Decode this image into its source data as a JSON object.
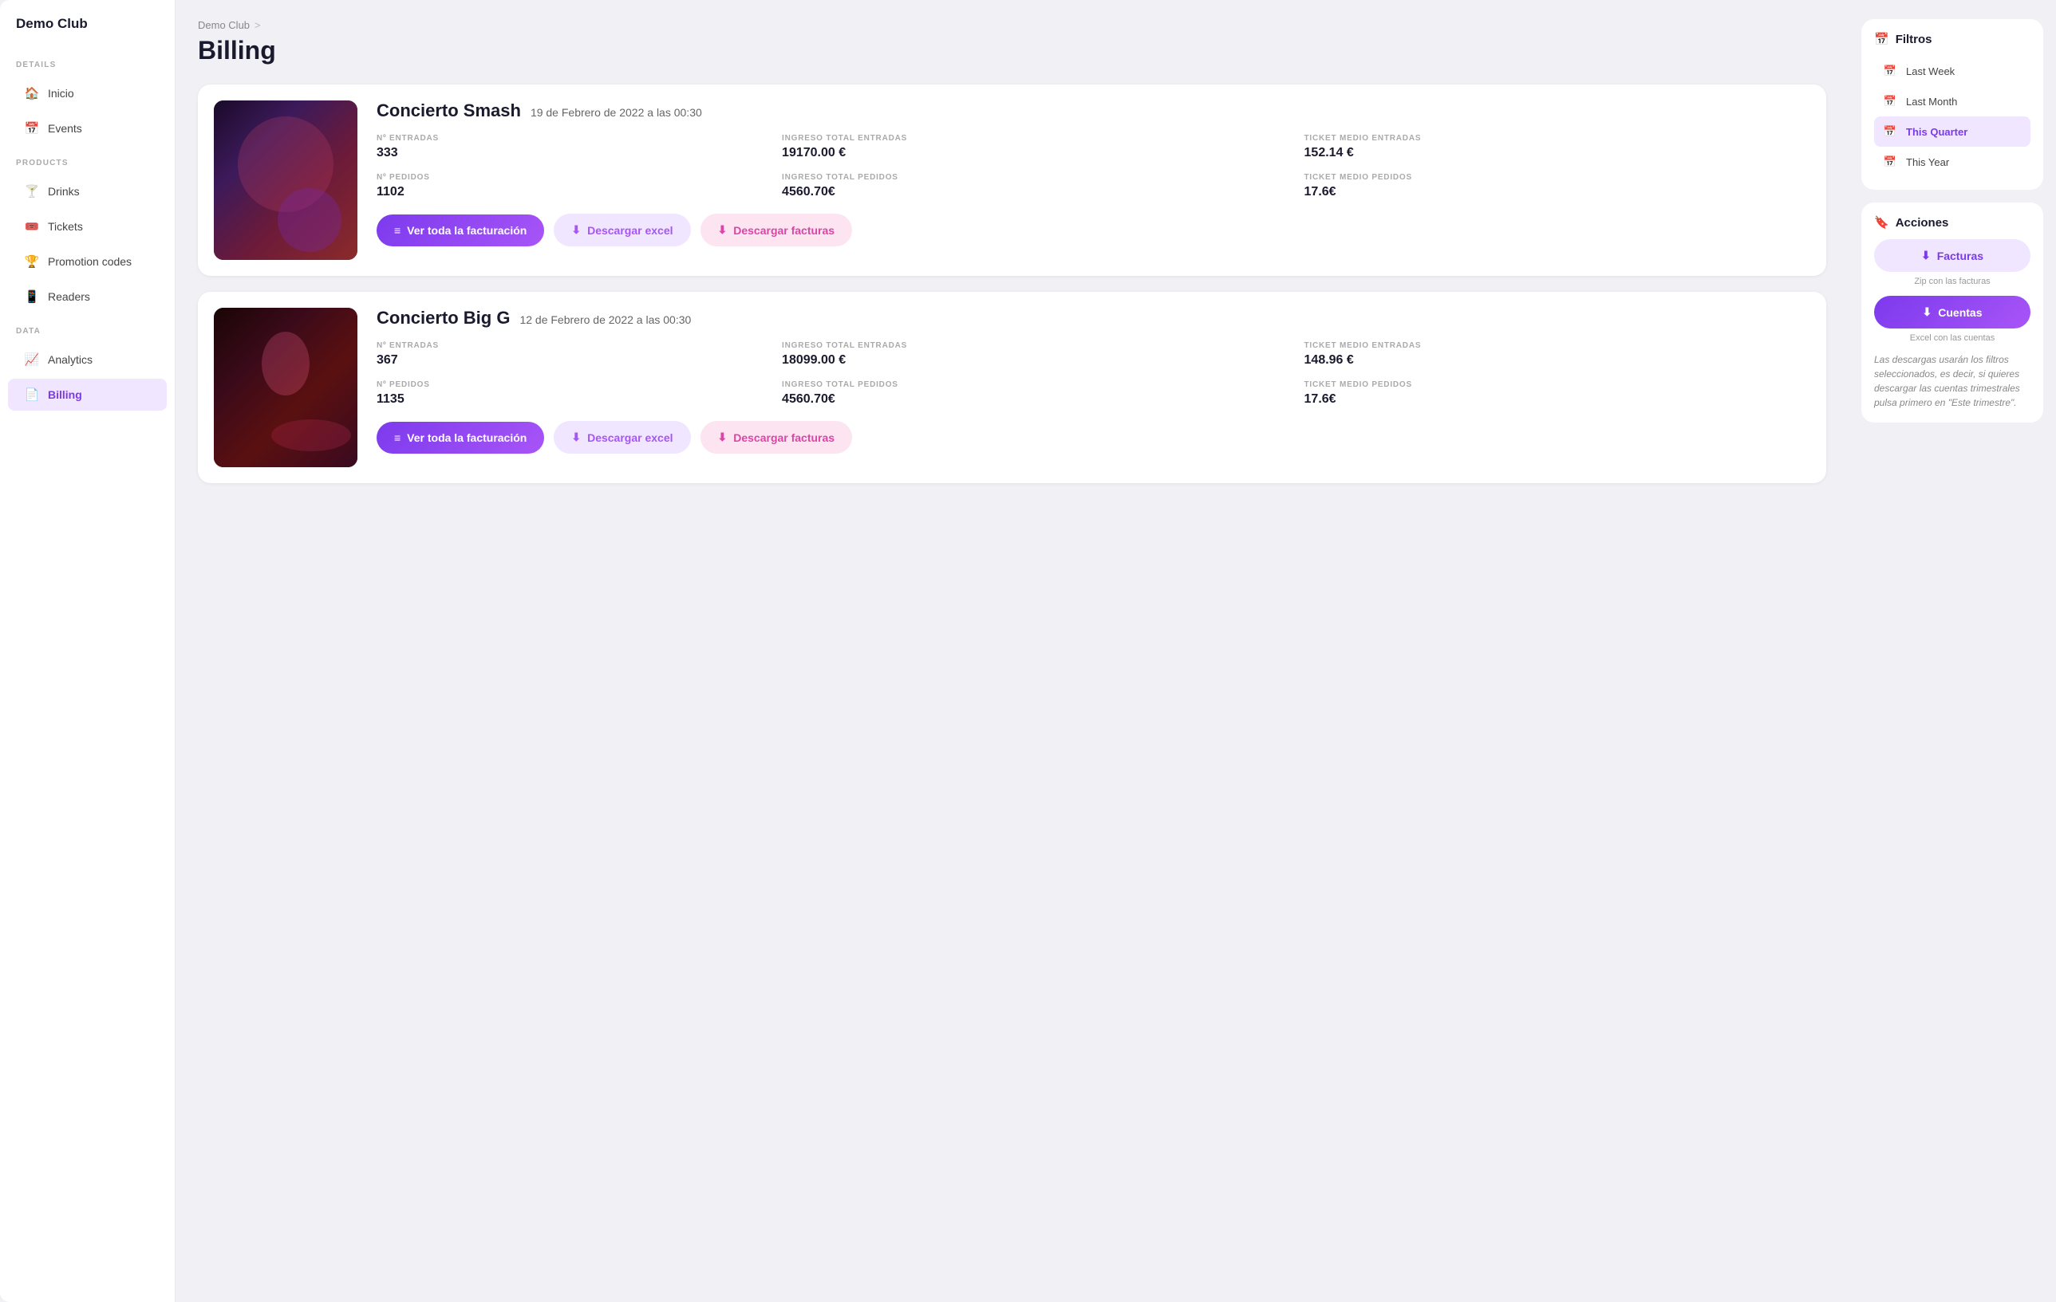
{
  "brand": "Demo Club",
  "breadcrumb": {
    "parent": "Demo Club",
    "separator": ">",
    "current": "Billing"
  },
  "page_title": "Billing",
  "sidebar": {
    "details_label": "DETAILS",
    "products_label": "PRODUCTS",
    "data_label": "DATA",
    "items": [
      {
        "id": "inicio",
        "label": "Inicio",
        "icon": "🏠"
      },
      {
        "id": "events",
        "label": "Events",
        "icon": "📅"
      },
      {
        "id": "drinks",
        "label": "Drinks",
        "icon": "🍸"
      },
      {
        "id": "tickets",
        "label": "Tickets",
        "icon": "🎟️"
      },
      {
        "id": "promotion-codes",
        "label": "Promotion codes",
        "icon": "🏆"
      },
      {
        "id": "readers",
        "label": "Readers",
        "icon": "📱"
      },
      {
        "id": "analytics",
        "label": "Analytics",
        "icon": "📈"
      },
      {
        "id": "billing",
        "label": "Billing",
        "icon": "📄",
        "active": true
      }
    ]
  },
  "events": [
    {
      "id": "event1",
      "name": "Concierto Smash",
      "date": "19 de Febrero de 2022 a las 00:30",
      "stats": [
        {
          "label": "Nº ENTRADAS",
          "value": "333"
        },
        {
          "label": "INGRESO TOTAL ENTRADAS",
          "value": "19170.00 €"
        },
        {
          "label": "TICKET MEDIO ENTRADAS",
          "value": "152.14 €"
        },
        {
          "label": "Nº PEDIDOS",
          "value": "1102"
        },
        {
          "label": "INGRESO TOTAL PEDIDOS",
          "value": "4560.70€"
        },
        {
          "label": "TICKET MEDIO PEDIDOS",
          "value": "17.6€"
        }
      ],
      "btn_ver": "Ver toda la facturación",
      "btn_excel": "Descargar excel",
      "btn_facturas": "Descargar facturas",
      "img_class": "img-concert1"
    },
    {
      "id": "event2",
      "name": "Concierto Big G",
      "date": "12 de Febrero de 2022 a las 00:30",
      "stats": [
        {
          "label": "Nº ENTRADAS",
          "value": "367"
        },
        {
          "label": "INGRESO TOTAL ENTRADAS",
          "value": "18099.00 €"
        },
        {
          "label": "TICKET MEDIO ENTRADAS",
          "value": "148.96 €"
        },
        {
          "label": "Nº PEDIDOS",
          "value": "1135"
        },
        {
          "label": "INGRESO TOTAL PEDIDOS",
          "value": "4560.70€"
        },
        {
          "label": "TICKET MEDIO PEDIDOS",
          "value": "17.6€"
        }
      ],
      "btn_ver": "Ver toda la facturación",
      "btn_excel": "Descargar excel",
      "btn_facturas": "Descargar facturas",
      "img_class": "img-concert2"
    }
  ],
  "filters": {
    "title": "Filtros",
    "options": [
      {
        "id": "last-week",
        "label": "Last Week"
      },
      {
        "id": "last-month",
        "label": "Last Month"
      },
      {
        "id": "this-quarter",
        "label": "This Quarter",
        "selected": true
      },
      {
        "id": "this-year",
        "label": "This Year"
      }
    ]
  },
  "acciones": {
    "title": "Acciones",
    "btn_facturas_label": "Facturas",
    "btn_facturas_subtext": "Zip con las facturas",
    "btn_cuentas_label": "Cuentas",
    "btn_cuentas_subtext": "Excel con las cuentas",
    "disclaimer": "Las descargas usarán los filtros seleccionados, es decir, si quieres descargar las cuentas trimestrales pulsa primero en \"Este trimestre\"."
  }
}
